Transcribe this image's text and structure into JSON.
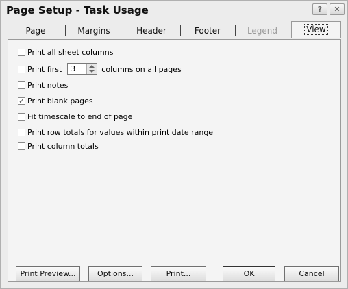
{
  "window": {
    "title": "Page Setup - Task Usage",
    "help_label": "?",
    "close_label": "✕"
  },
  "tabs": [
    {
      "label": "Page"
    },
    {
      "label": "Margins"
    },
    {
      "label": "Header"
    },
    {
      "label": "Footer"
    },
    {
      "label": "Legend"
    },
    {
      "label": "View"
    }
  ],
  "options": {
    "print_all_sheet_columns": {
      "label": "Print all sheet columns",
      "checked": false
    },
    "print_first": {
      "prefix": "Print first",
      "value": "3",
      "suffix": "columns on all pages",
      "checked": false
    },
    "print_notes": {
      "label": "Print notes",
      "checked": false
    },
    "print_blank_pages": {
      "label": "Print blank pages",
      "checked": true
    },
    "fit_timescale": {
      "label": "Fit timescale to end of page",
      "checked": false
    },
    "print_row_totals": {
      "label": "Print row totals for values within print date range",
      "checked": false
    },
    "print_column_totals": {
      "label": "Print column totals",
      "checked": false
    }
  },
  "buttons": {
    "print_preview": "Print Preview...",
    "options": "Options...",
    "print": "Print...",
    "ok": "OK",
    "cancel": "Cancel"
  }
}
